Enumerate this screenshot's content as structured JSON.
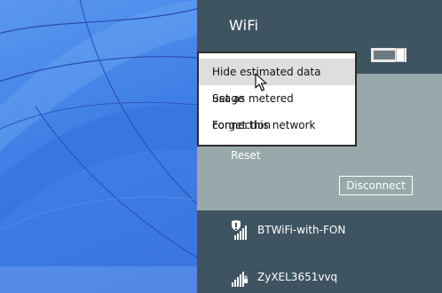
{
  "pane": {
    "title": "WiFi",
    "reset_label": "Reset",
    "disconnect_label": "Disconnect"
  },
  "networks": [
    {
      "name": "BTWiFi-with-FON",
      "secured": false,
      "icon": "wifi-shield-icon"
    },
    {
      "name": "ZyXEL3651vvq",
      "secured": true,
      "icon": "wifi-signal-icon"
    }
  ],
  "context_menu": {
    "items": [
      {
        "label": "Hide estimated data usage",
        "hovered": true
      },
      {
        "label": "Set as metered connection",
        "hovered": false
      },
      {
        "label": "Forget this network",
        "hovered": false
      }
    ]
  },
  "colors": {
    "pane_bg": "#3f5461",
    "expanded_bg": "#97a9aa",
    "wallpaper": "#3f7fe6",
    "menu_hover": "#dedede"
  }
}
